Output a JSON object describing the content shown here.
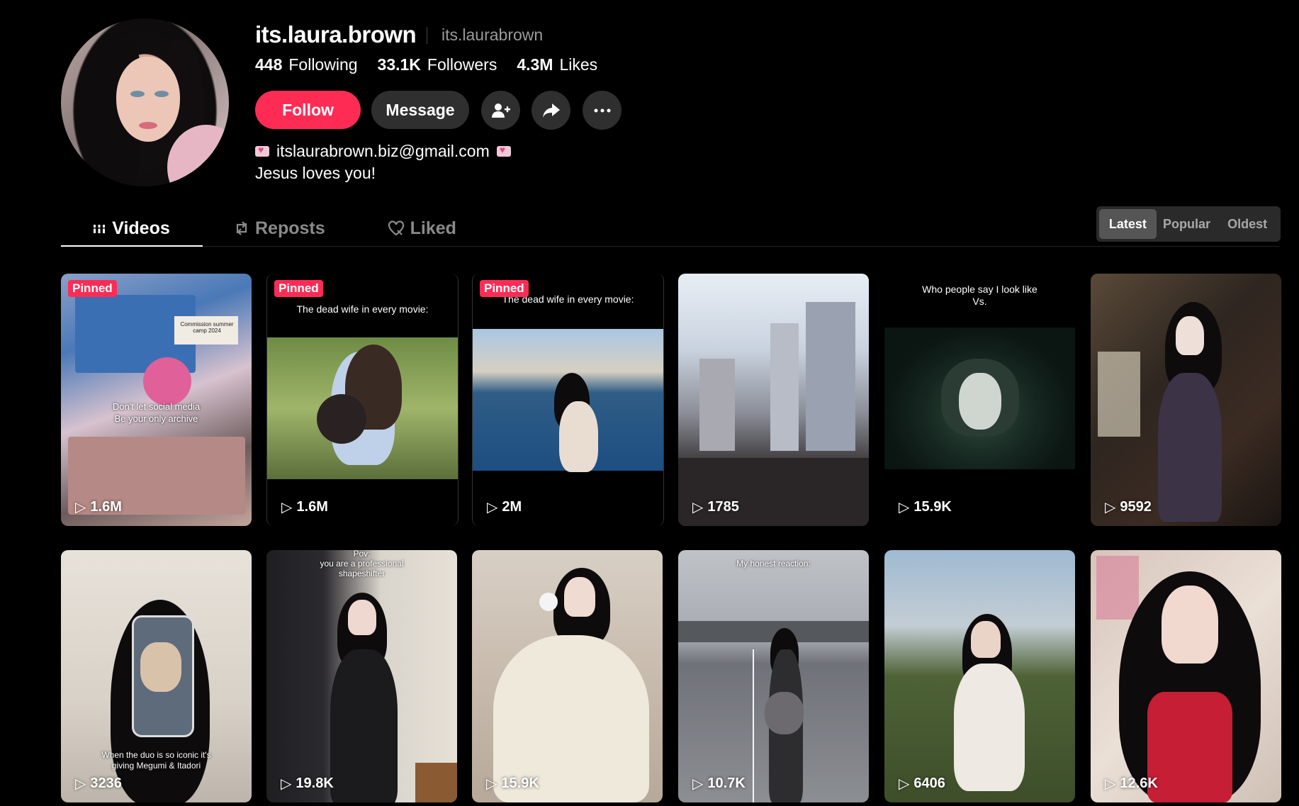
{
  "profile": {
    "username": "its.laura.brown",
    "nickname": "its.laurabrown",
    "stats": [
      {
        "value": "448",
        "label": "Following"
      },
      {
        "value": "33.1K",
        "label": "Followers"
      },
      {
        "value": "4.3M",
        "label": "Likes"
      }
    ],
    "bio_email": "itslaurabrown.biz@gmail.com",
    "bio_line2": "Jesus loves you!"
  },
  "actions": {
    "follow": "Follow",
    "message": "Message",
    "add_friend_icon": "person-plus-icon",
    "share_icon": "share-arrow-icon",
    "more_icon": "more-dots-icon"
  },
  "tabs": [
    {
      "label": "Videos",
      "icon": "grid-icon",
      "active": true
    },
    {
      "label": "Reposts",
      "icon": "repost-icon",
      "active": false
    },
    {
      "label": "Liked",
      "icon": "heart-icon",
      "active": false
    }
  ],
  "sort": {
    "options": [
      "Latest",
      "Popular",
      "Oldest"
    ],
    "selected": "Latest"
  },
  "videos": [
    {
      "views": "1.6M",
      "pinned": "Pinned",
      "captions": [
        "Commission summer camp 2024",
        "Don't let social media",
        "Be your only archive"
      ]
    },
    {
      "views": "1.6M",
      "pinned": "Pinned",
      "captions": [
        "The dead wife in every movie:"
      ]
    },
    {
      "views": "2M",
      "pinned": "Pinned",
      "captions": [
        "The dead wife in every movie:"
      ]
    },
    {
      "views": "1785",
      "pinned": "",
      "captions": []
    },
    {
      "views": "15.9K",
      "pinned": "",
      "captions": [
        "Who people say I look like",
        "Vs."
      ]
    },
    {
      "views": "9592",
      "pinned": "",
      "captions": []
    },
    {
      "views": "3236",
      "pinned": "",
      "captions": [
        "When the duo is so iconic it's",
        "giving Megumi & Itadori"
      ]
    },
    {
      "views": "19.8K",
      "pinned": "",
      "captions": [
        "Pov:",
        "you are a professional",
        "shapeshifter"
      ]
    },
    {
      "views": "15.9K",
      "pinned": "",
      "captions": []
    },
    {
      "views": "10.7K",
      "pinned": "",
      "captions": [
        "My honest reaction:"
      ]
    },
    {
      "views": "6406",
      "pinned": "",
      "captions": []
    },
    {
      "views": "12.6K",
      "pinned": "",
      "captions": []
    }
  ],
  "colors": {
    "accent": "#fe2c55",
    "background": "#000000",
    "button_dark": "#2f2f2f"
  }
}
